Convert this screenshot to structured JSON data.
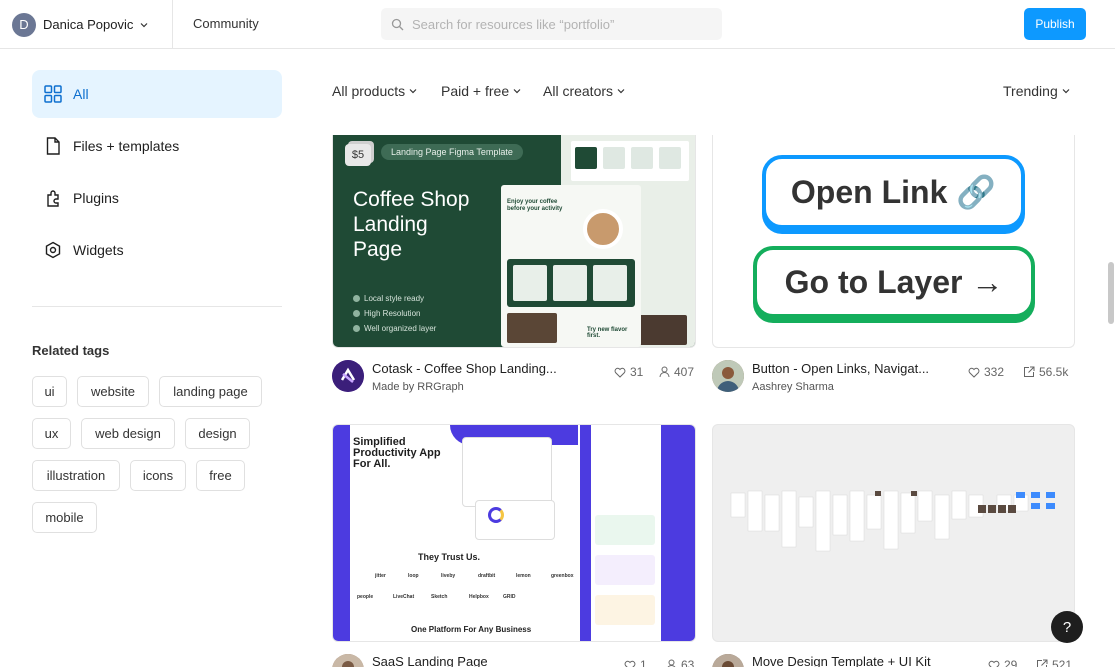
{
  "header": {
    "user": {
      "initial": "D",
      "name": "Danica Popovic"
    },
    "community": "Community",
    "search": {
      "placeholder": "Search for resources like “portfolio”",
      "value": ""
    },
    "publish": "Publish"
  },
  "sidebar": {
    "items": [
      {
        "label": "All",
        "icon": "grid-icon",
        "active": true
      },
      {
        "label": "Files + templates",
        "icon": "file-icon"
      },
      {
        "label": "Plugins",
        "icon": "plugin-icon"
      },
      {
        "label": "Widgets",
        "icon": "widget-icon"
      }
    ],
    "related_tags_title": "Related tags",
    "tags": [
      "ui",
      "website",
      "landing page",
      "ux",
      "web design",
      "design",
      "illustration",
      "icons",
      "free",
      "mobile"
    ]
  },
  "filters": {
    "products": "All products",
    "price": "Paid + free",
    "creators": "All creators",
    "sort": "Trending"
  },
  "cards": [
    {
      "thumb": {
        "price": "$5",
        "pill": "Landing Page Figma Template",
        "title_lines": [
          "Coffee Shop",
          "Landing",
          "Page"
        ],
        "features": [
          "Local style ready",
          "High Resolution",
          "Well organized layer"
        ],
        "mock_heading": "Enjoy your coffee before your activity",
        "mock_footer": "Try new flavor first."
      },
      "title": "Cotask - Coffee Shop Landing...",
      "author": "Made by RRGraph",
      "likes": "31",
      "users": "407"
    },
    {
      "thumb": {
        "primary": "Open Link 🔗",
        "secondary": "Go to Layer →"
      },
      "title": "Button - Open Links, Navigat...",
      "author": "Aashrey Sharma",
      "likes": "332",
      "users": "56.5k"
    },
    {
      "thumb": {
        "headline": "Simplified Productivity App For All.",
        "trust": "They Trust Us.",
        "platform": "One Platform For Any Business",
        "logos": [
          "jitter",
          "loop",
          "liveby",
          "draftbit",
          "lemon",
          "greenbox",
          "people",
          "LiveChat",
          "Sketch",
          "Helpbox",
          "GRID"
        ]
      },
      "title": "SaaS Landing Page",
      "likes": "1",
      "users": "63"
    },
    {
      "thumb": {},
      "title": "Move Design Template + UI Kit",
      "likes": "29",
      "users": "521"
    }
  ],
  "help": "?",
  "colors": {
    "accent": "#0d99ff",
    "active_bg": "#e5f4ff",
    "green": "#14ae5c",
    "coffee": "#1f4a35",
    "saas": "#4c3be0"
  }
}
